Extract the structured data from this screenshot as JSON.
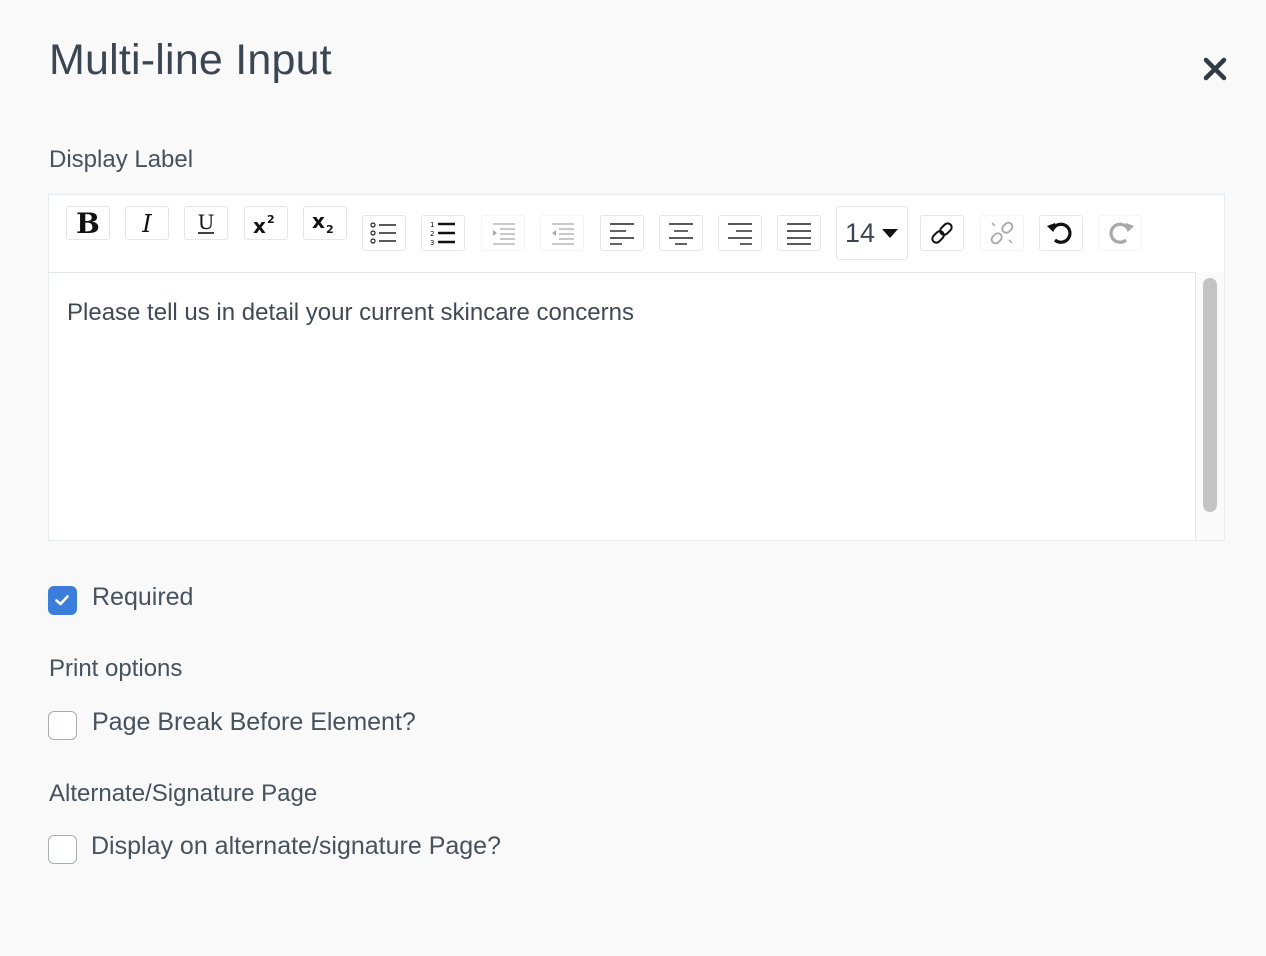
{
  "modal": {
    "title": "Multi-line Input"
  },
  "display_label": {
    "heading": "Display Label",
    "editor": {
      "font_size": "14",
      "content": "Please tell us in detail your current skincare concerns",
      "toolbar_icons": [
        "bold-icon",
        "italic-icon",
        "underline-icon",
        "superscript-icon",
        "subscript-icon",
        "bullet-list-icon",
        "numbered-list-icon",
        "indent-icon",
        "outdent-icon",
        "align-left-icon",
        "align-center-icon",
        "align-right-icon",
        "align-justify-icon",
        "link-icon",
        "unlink-icon",
        "undo-icon",
        "redo-icon"
      ]
    }
  },
  "required": {
    "label": "Required",
    "checked": true
  },
  "print_options": {
    "heading": "Print options",
    "page_break_label": "Page Break Before Element?",
    "page_break_checked": false
  },
  "alternate_page": {
    "heading": "Alternate/Signature Page",
    "display_label": "Display on alternate/signature Page?",
    "display_checked": false
  },
  "colors": {
    "accent": "#3b7ddd",
    "text": "#3d4a57",
    "background": "#f9f9f9"
  }
}
